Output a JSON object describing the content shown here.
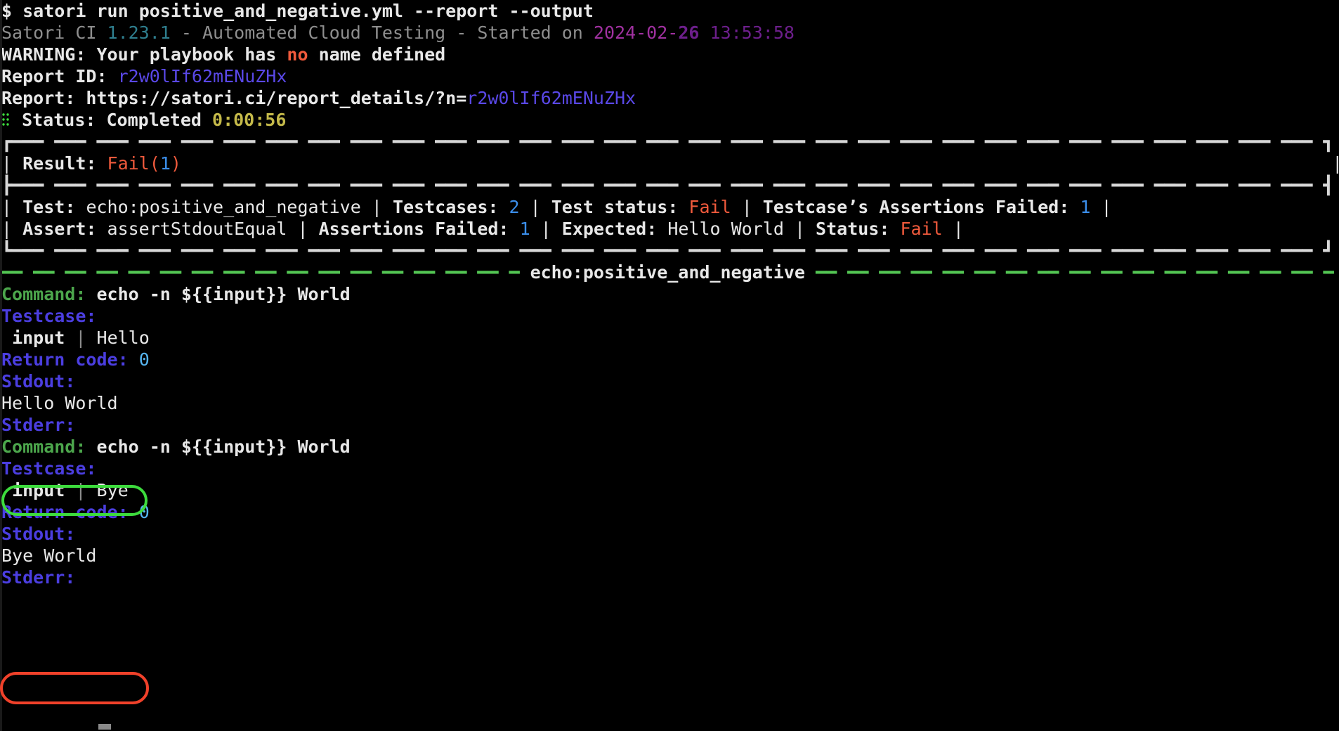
{
  "terminal": {
    "prompt": "$",
    "command": "satori run positive_and_negative.yml --report --output",
    "banner": {
      "app": "Satori CI",
      "version": "1.23.1",
      "tagline": "- Automated Cloud Testing - Started on",
      "date": "2024-02-",
      "date_day": "26",
      "time": "13:53:58"
    },
    "warning": {
      "label": "WARNING:",
      "text_before": "Your playbook has",
      "highlight": "no",
      "text_after": "name defined"
    },
    "report_id": {
      "label": "Report ID:",
      "value": "r2w0lIf62mENuZHx"
    },
    "report_url": {
      "label": "Report:",
      "base": "https://satori.ci/report_details/?n=",
      "id": "r2w0lIf62mENuZHx"
    },
    "status": {
      "icon": "spinner-dots-icon",
      "label": "Status:",
      "value": "Completed",
      "elapsed": "0:00:56"
    },
    "result_box": {
      "result_label": "Result:",
      "result_value": "Fail",
      "result_count_open": "(",
      "result_count": "1",
      "result_count_close": ")",
      "rows": [
        {
          "cells": [
            {
              "label": "Test:",
              "value": "echo:positive_and_negative",
              "value_color": "white"
            },
            {
              "label": "Testcases:",
              "value": "2",
              "value_color": "blue"
            },
            {
              "label": "Test status:",
              "value": "Fail",
              "value_color": "red"
            },
            {
              "label": "Testcase’s Assertions Failed:",
              "value": "1",
              "value_color": "blue"
            }
          ]
        },
        {
          "cells": [
            {
              "label": "Assert:",
              "value": "assertStdoutEqual",
              "value_color": "white"
            },
            {
              "label": "Assertions Failed:",
              "value": "1",
              "value_color": "blue"
            },
            {
              "label": "Expected:",
              "value": "Hello World",
              "value_color": "white"
            },
            {
              "label": "Status:",
              "value": "Fail",
              "value_color": "red"
            }
          ]
        }
      ]
    },
    "section_title": "echo:positive_and_negative",
    "testcases": [
      {
        "command_label": "Command:",
        "command_value": "echo -n ${{input}} World",
        "testcase_label": "Testcase:",
        "input_key": "input",
        "input_sep": "|",
        "input_value": "Hello",
        "return_label": "Return code:",
        "return_value": "0",
        "stdout_label": "Stdout:",
        "stdout_value": "Hello World",
        "stdout_annotation": "green",
        "stderr_label": "Stderr:",
        "stderr_value": ""
      },
      {
        "command_label": "Command:",
        "command_value": "echo -n ${{input}} World",
        "testcase_label": "Testcase:",
        "input_key": "input",
        "input_sep": "|",
        "input_value": "Bye",
        "return_label": "Return code:",
        "return_value": "0",
        "stdout_label": "Stdout:",
        "stdout_value": "Bye World",
        "stdout_annotation": "red",
        "stderr_label": "Stderr:",
        "stderr_value": ""
      }
    ],
    "colors": {
      "background": "#000000",
      "foreground": "#d8d8d8",
      "fail": "#ef4a35",
      "pass": "#53c653",
      "number": "#3b8eea",
      "label": "#4b3ee0",
      "command": "#4ca64c",
      "elapsed": "#c5ba4a",
      "annotation_green": "#3ddb3d",
      "annotation_red": "#f0412a"
    }
  }
}
